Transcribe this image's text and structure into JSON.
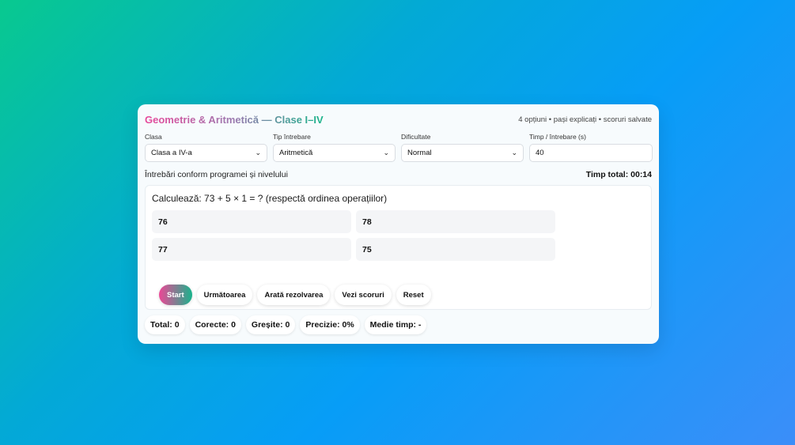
{
  "header": {
    "title": "Geometrie & Aritmetică — Clase I–IV",
    "tagline": "4 opțiuni • pași explicați • scoruri salvate"
  },
  "controls": {
    "clasa": {
      "label": "Clasa",
      "value": "Clasa a IV-a"
    },
    "tip": {
      "label": "Tip întrebare",
      "value": "Aritmetică"
    },
    "dificultate": {
      "label": "Dificultate",
      "value": "Normal"
    },
    "timp": {
      "label": "Timp / întrebare (s)",
      "value": "40"
    }
  },
  "info": {
    "text": "Întrebări conform programei și nivelului",
    "timer": "Timp total: 00:14"
  },
  "question": {
    "text": "Calculează: 73 + 5 × 1 = ? (respectă ordinea operațiilor)",
    "options": [
      "76",
      "78",
      "77",
      "75"
    ]
  },
  "actions": {
    "start": "Start",
    "next": "Următoarea",
    "solution": "Arată rezolvarea",
    "scores": "Vezi scoruri",
    "reset": "Reset"
  },
  "stats": {
    "total": "Total: 0",
    "correct": "Corecte: 0",
    "wrong": "Greșite: 0",
    "precision": "Precizie: 0%",
    "avg_time": "Medie timp: -"
  },
  "colors": {
    "title_gradient_start": "#e8489a",
    "title_gradient_end": "#19b48a",
    "start_button_start": "#ec4796",
    "start_button_end": "#19b38c"
  }
}
